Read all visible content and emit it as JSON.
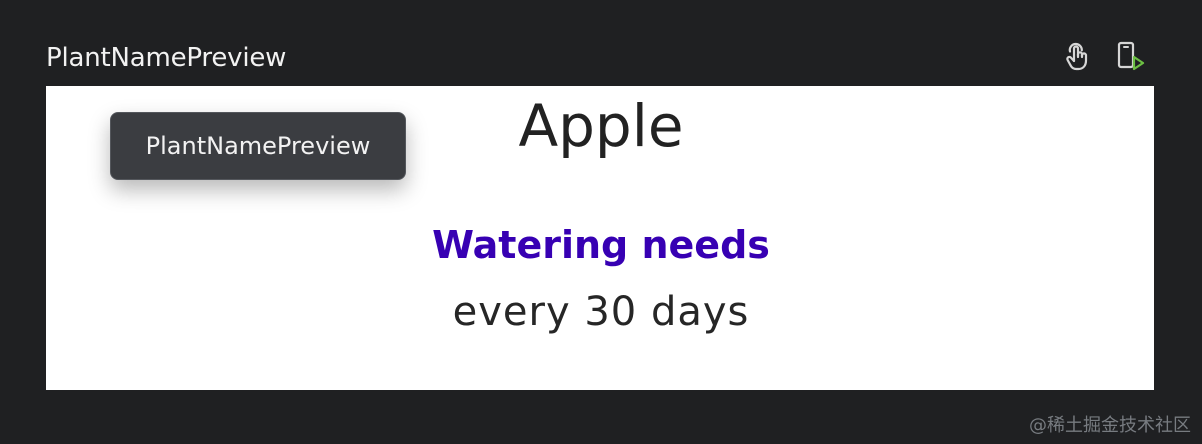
{
  "preview": {
    "title": "PlantNamePreview",
    "tooltip": "PlantNamePreview"
  },
  "toolbar": {
    "interactive_icon": "touch-icon",
    "run_icon": "device-run-icon",
    "run_icon_accent": "#6cbf43"
  },
  "content": {
    "plant_name": "Apple",
    "watering_label": "Watering needs",
    "watering_value": "every 30 days",
    "watering_label_color": "#3700b3"
  },
  "watermark": "@稀土掘金技术社区"
}
